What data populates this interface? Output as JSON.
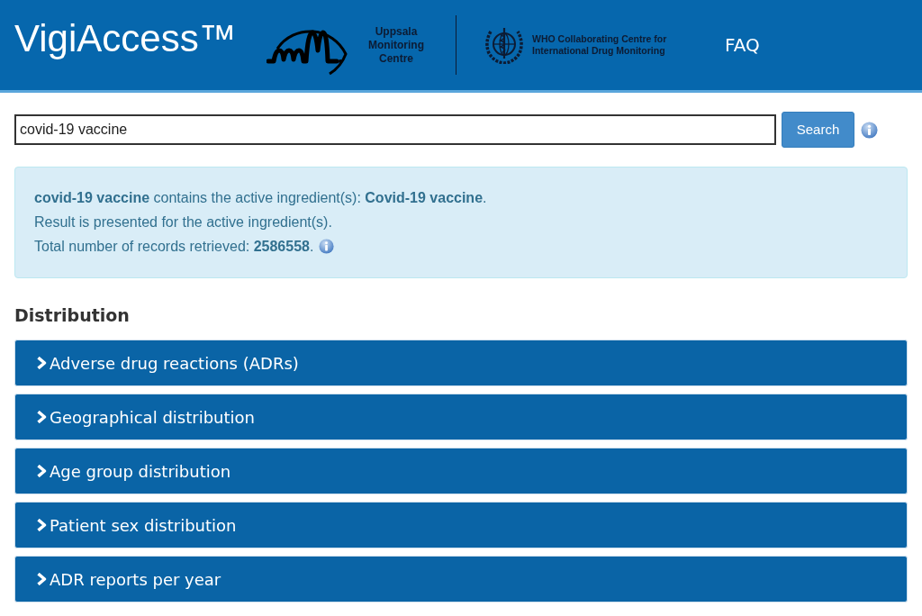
{
  "header": {
    "title": "VigiAccess™",
    "umc_logo": {
      "lines": [
        "Uppsala",
        "Monitoring",
        "Centre"
      ]
    },
    "who_logo": {
      "lines": [
        "WHO Collaborating Centre for",
        "International Drug Monitoring"
      ]
    },
    "nav": [
      {
        "label": "FAQ"
      }
    ]
  },
  "search": {
    "value": "covid-19 vaccine",
    "button": "Search"
  },
  "result_alert": {
    "lines": [
      "**covid-19 vaccine** contains the active ingredient(s): **Covid-19 vaccine**.",
      "Result is presented for the active ingredient(s).",
      "Total number of records retrieved: **2586558**."
    ]
  },
  "distribution": {
    "heading": "Distribution",
    "sections": [
      {
        "label": "Adverse drug reactions (ADRs)",
        "expanded": false
      },
      {
        "label": "Geographical distribution",
        "expanded": false
      },
      {
        "label": "Age group distribution",
        "expanded": false
      },
      {
        "label": "Patient sex distribution",
        "expanded": false
      },
      {
        "label": "ADR reports per year",
        "expanded": false
      }
    ]
  }
}
